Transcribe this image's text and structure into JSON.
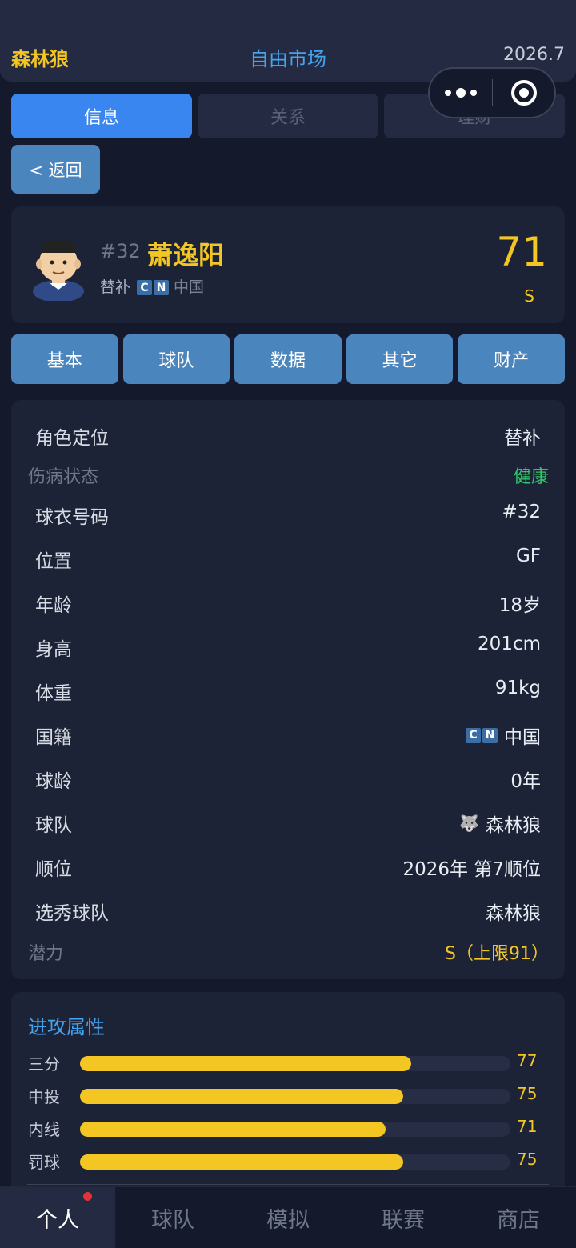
{
  "header": {
    "team": "森林狼",
    "title": "自由市场",
    "date": "2026.7"
  },
  "main_tabs": [
    "信息",
    "关系",
    "理财"
  ],
  "back_label": "< 返回",
  "player": {
    "number": "#32",
    "name": "萧逸阳",
    "role": "替补",
    "flag_letters": [
      "C",
      "N"
    ],
    "country": "中国",
    "overall": "71",
    "grade": "S"
  },
  "sub_tabs": [
    "基本",
    "球队",
    "数据",
    "其它",
    "财产"
  ],
  "info": {
    "role_label": "角色定位",
    "role_value": "替补",
    "injury_label": "伤病状态",
    "injury_value": "健康",
    "jersey_label": "球衣号码",
    "jersey_value": "#32",
    "position_label": "位置",
    "position_value": "GF",
    "age_label": "年龄",
    "age_value": "18岁",
    "height_label": "身高",
    "height_value": "201cm",
    "weight_label": "体重",
    "weight_value": "91kg",
    "nationality_label": "国籍",
    "nationality_value": "中国",
    "experience_label": "球龄",
    "experience_value": "0年",
    "team_label": "球队",
    "team_value": "森林狼",
    "draft_label": "顺位",
    "draft_value": "2026年 第7顺位",
    "draft_team_label": "选秀球队",
    "draft_team_value": "森林狼",
    "potential_label": "潜力",
    "potential_value": "S（上限91）"
  },
  "attack": {
    "title": "进攻属性",
    "items": [
      {
        "label": "三分",
        "value": "77"
      },
      {
        "label": "中投",
        "value": "75"
      },
      {
        "label": "内线",
        "value": "71"
      },
      {
        "label": "罚球",
        "value": "75"
      }
    ]
  },
  "bottom_nav": [
    "个人",
    "球队",
    "模拟",
    "联赛",
    "商店"
  ],
  "colors": {
    "accent_blue": "#3a86f0",
    "gold": "#f3c623",
    "healthy": "#33c66b",
    "badge_red": "#e0333a"
  }
}
